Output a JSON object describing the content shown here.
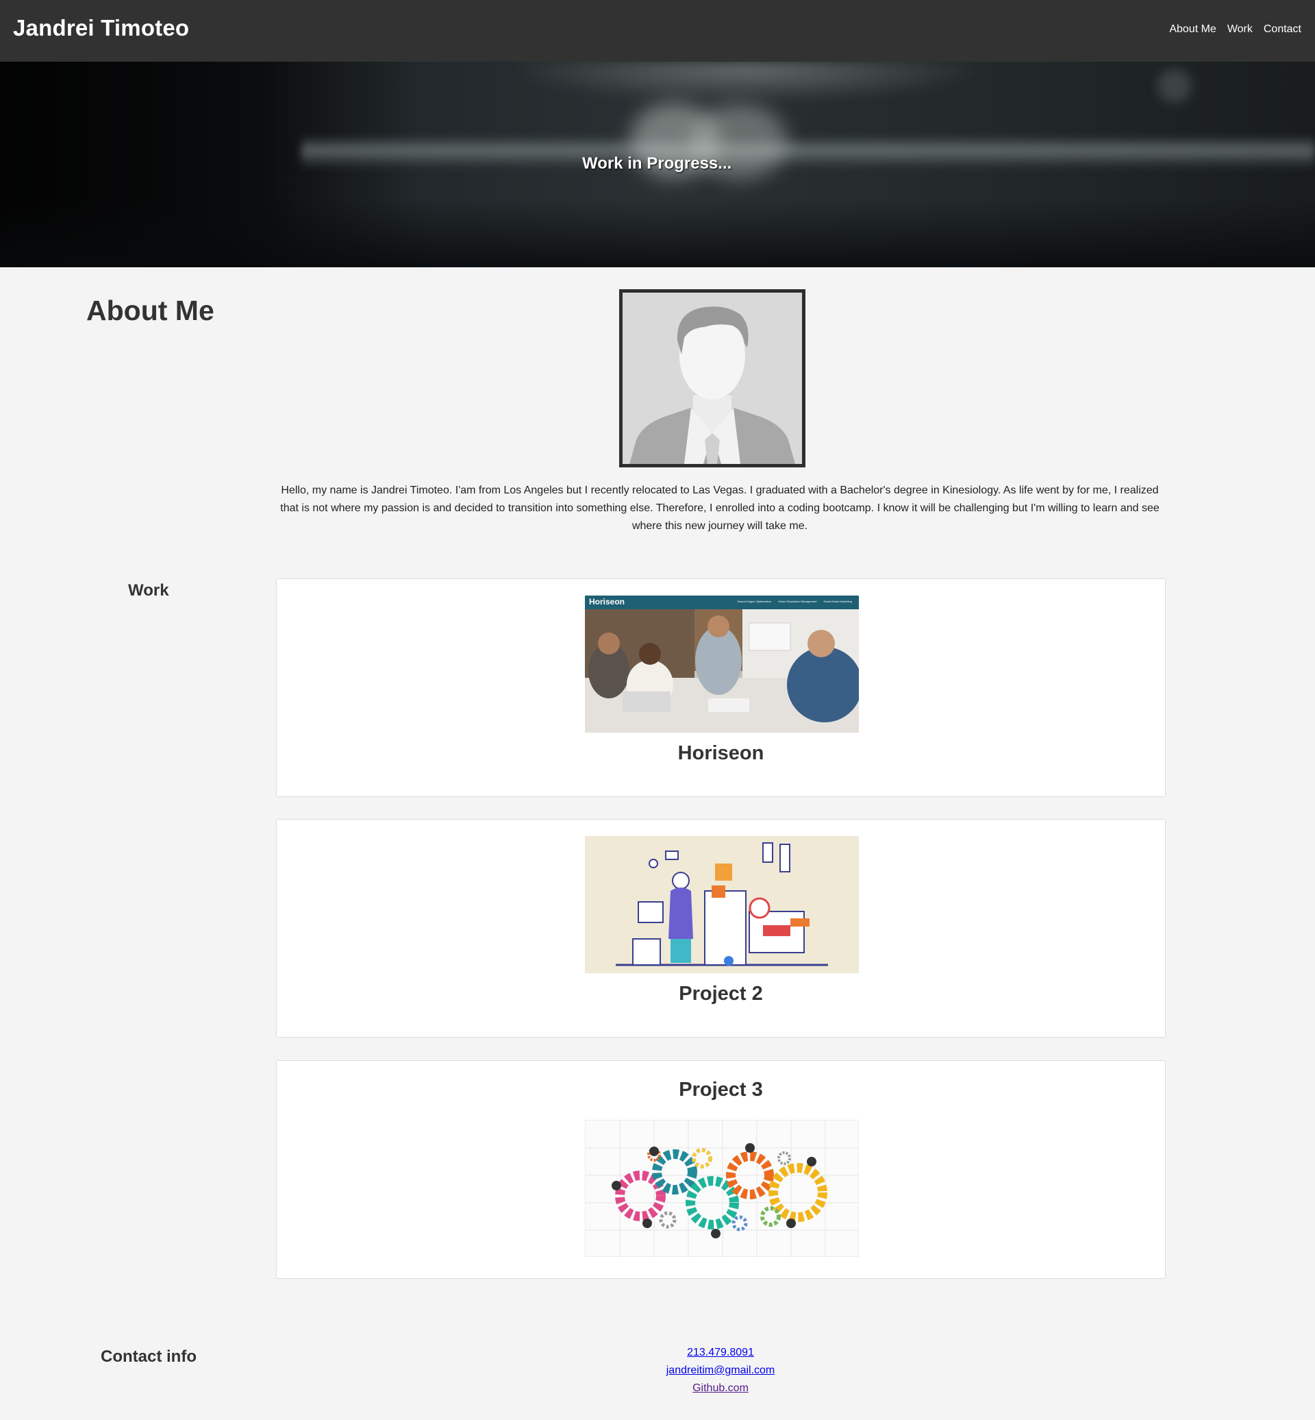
{
  "header": {
    "brand": "Jandrei Timoteo",
    "nav": [
      "About Me",
      "Work",
      "Contact"
    ]
  },
  "hero": {
    "text": "Work in Progress..."
  },
  "about": {
    "heading": "About Me",
    "bio": "Hello, my name is Jandrei Timoteo. I'am from Los Angeles but I recently relocated to Las Vegas. I graduated with a Bachelor's degree in Kinesiology. As life went by for me, I realized that is not where my passion is and decided to transition into something else. Therefore, I enrolled into a coding bootcamp. I know it will be challenging but I'm willing to learn and see where this new journey will take me."
  },
  "work": {
    "heading": "Work",
    "projects": [
      {
        "title": "Horiseon",
        "thumb_brand": "Horiseon",
        "thumb_nav": [
          "Search Engine Optimization",
          "Online Reputation Management",
          "Social Media Marketing"
        ]
      },
      {
        "title": "Project 2"
      },
      {
        "title": "Project 3"
      }
    ]
  },
  "contact": {
    "heading": "Contact info",
    "phone": "213.479.8091",
    "email": "jandreitim@gmail.com",
    "github": "Github.com"
  },
  "colors": {
    "header_bg": "#323232",
    "page_bg": "#f4f4f4",
    "link": "#0000ee",
    "visited_link": "#551a8b"
  }
}
